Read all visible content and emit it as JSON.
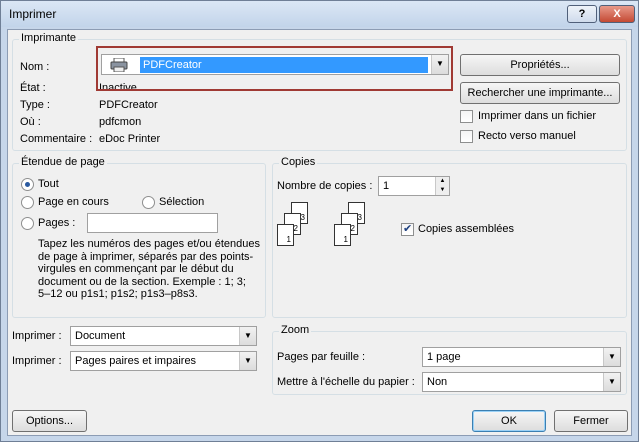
{
  "window": {
    "title": "Imprimer",
    "help_label": "?",
    "close_label": "X"
  },
  "printer": {
    "group_label": "Imprimante",
    "name_label": "Nom :",
    "name_value": "PDFCreator",
    "status_label": "État :",
    "status_value": "Inactive",
    "type_label": "Type :",
    "type_value": "PDFCreator",
    "where_label": "Où :",
    "where_value": "pdfcmon",
    "comment_label": "Commentaire :",
    "comment_value": "eDoc Printer",
    "properties_button": "Propriétés...",
    "find_button": "Rechercher une imprimante...",
    "print_to_file_label": "Imprimer dans un fichier",
    "duplex_label": "Recto verso manuel",
    "print_to_file_checked": false,
    "duplex_checked": false,
    "highlight_color": "#a03a34",
    "selection_color": "#3399ff"
  },
  "page_range": {
    "group_label": "Étendue de page",
    "all_label": "Tout",
    "current_label": "Page en cours",
    "selection_label": "Sélection",
    "pages_label": "Pages :",
    "pages_value": "",
    "hint": "Tapez les numéros des pages et/ou étendues de page à imprimer, séparés par des points-virgules en commençant par le début du document ou de la section. Exemple : 1; 3; 5–12 ou p1s1; p1s2; p1s3–p8s3.",
    "selected": "Tout"
  },
  "copies": {
    "group_label": "Copies",
    "count_label": "Nombre de copies :",
    "count_value": "1",
    "collate_label": "Copies assemblées",
    "collate_checked": true,
    "page_numbers": [
      "3",
      "2",
      "1"
    ]
  },
  "print_what": {
    "label": "Imprimer :",
    "value": "Document",
    "pages_label": "Imprimer :",
    "pages_value": "Pages paires et impaires"
  },
  "zoom": {
    "group_label": "Zoom",
    "per_sheet_label": "Pages par feuille :",
    "per_sheet_value": "1 page",
    "scale_label": "Mettre à l'échelle du papier :",
    "scale_value": "Non"
  },
  "footer": {
    "options_button": "Options...",
    "ok_button": "OK",
    "close_button": "Fermer"
  }
}
